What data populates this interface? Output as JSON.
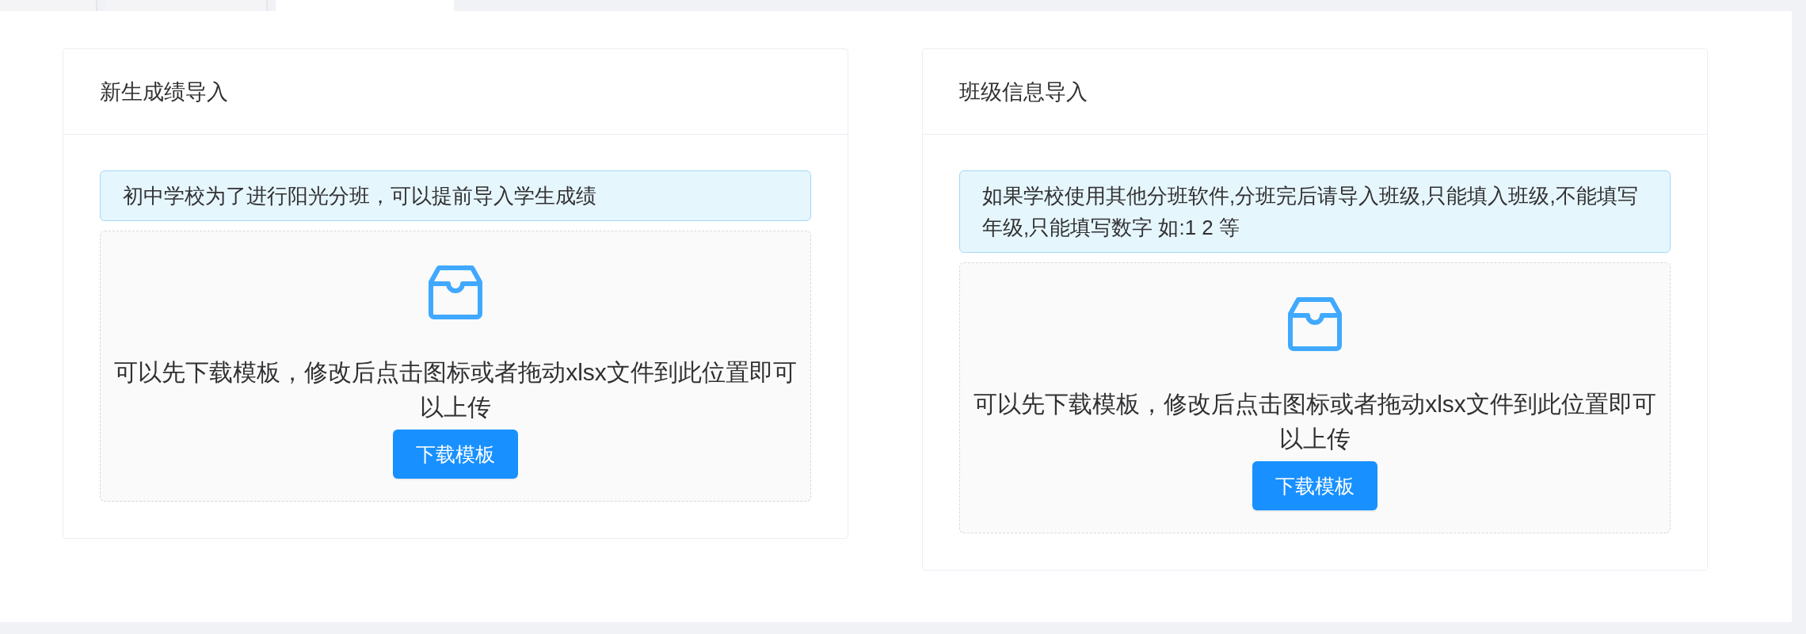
{
  "tabs": [
    {
      "selected": false
    },
    {
      "selected": false
    },
    {
      "selected": true
    }
  ],
  "cards": [
    {
      "title": "新生成绩导入",
      "notice": "初中学校为了进行阳光分班，可以提前导入学生成绩",
      "upload_hint": "可以先下载模板，修改后点击图标或者拖动xlsx文件到此位置即可以上传",
      "button": "下载模板"
    },
    {
      "title": "班级信息导入",
      "notice": "如果学校使用其他分班软件,分班完后请导入班级,只能填入班级,不能填写年级,只能填写数字 如:1 2 等",
      "upload_hint": "可以先下载模板，修改后点击图标或者拖动xlsx文件到此位置即可以上传",
      "button": "下载模板"
    }
  ]
}
